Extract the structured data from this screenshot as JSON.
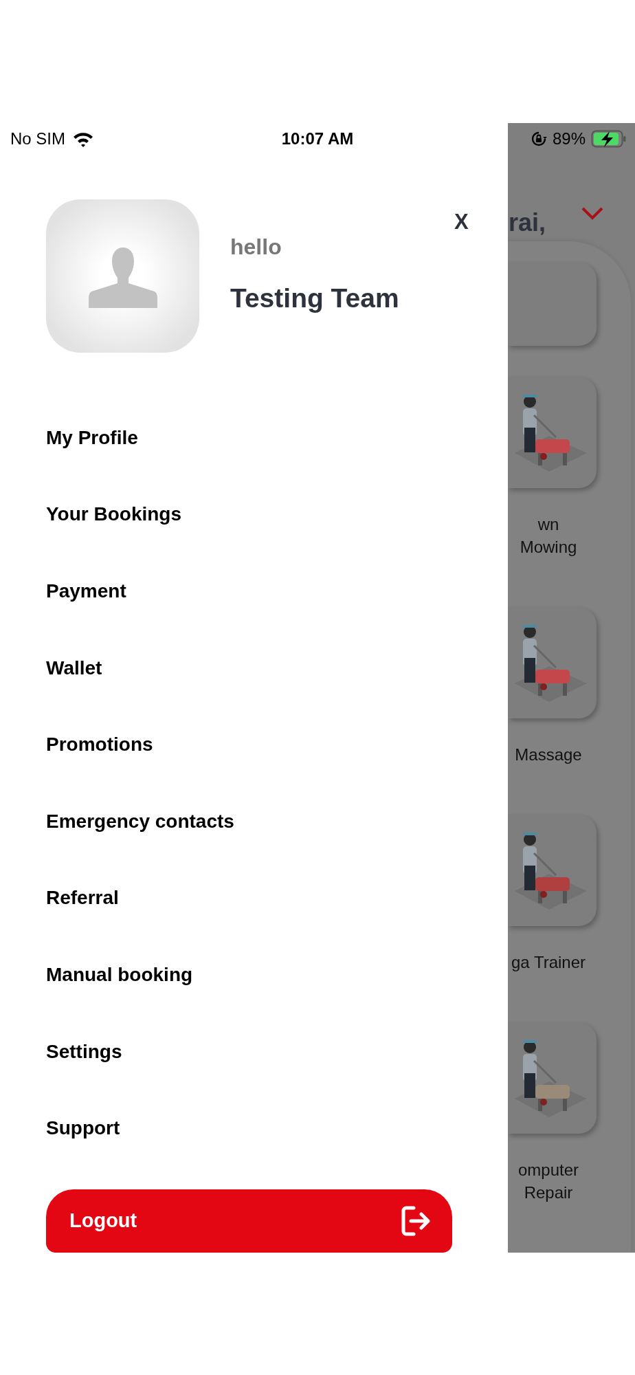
{
  "status_bar": {
    "carrier": "No SIM",
    "time": "10:07 AM",
    "battery": "89%"
  },
  "drawer": {
    "close": "X",
    "greeting": "hello",
    "name": "Testing Team",
    "menu": [
      {
        "label": "My Profile"
      },
      {
        "label": "Your Bookings"
      },
      {
        "label": "Payment"
      },
      {
        "label": "Wallet"
      },
      {
        "label": "Promotions"
      },
      {
        "label": "Emergency contacts"
      },
      {
        "label": "Referral"
      },
      {
        "label": "Manual booking"
      },
      {
        "label": "Settings"
      },
      {
        "label": "Support"
      }
    ],
    "logout": "Logout"
  },
  "background": {
    "heading": "rai,",
    "services": [
      {
        "kind": "blank"
      },
      {
        "kind": "picture",
        "label": "wn Mowing"
      },
      {
        "kind": "picture",
        "label": "Massage"
      },
      {
        "kind": "picture",
        "label": "ga Trainer"
      },
      {
        "kind": "picture",
        "label": "omputer Repair"
      }
    ]
  }
}
